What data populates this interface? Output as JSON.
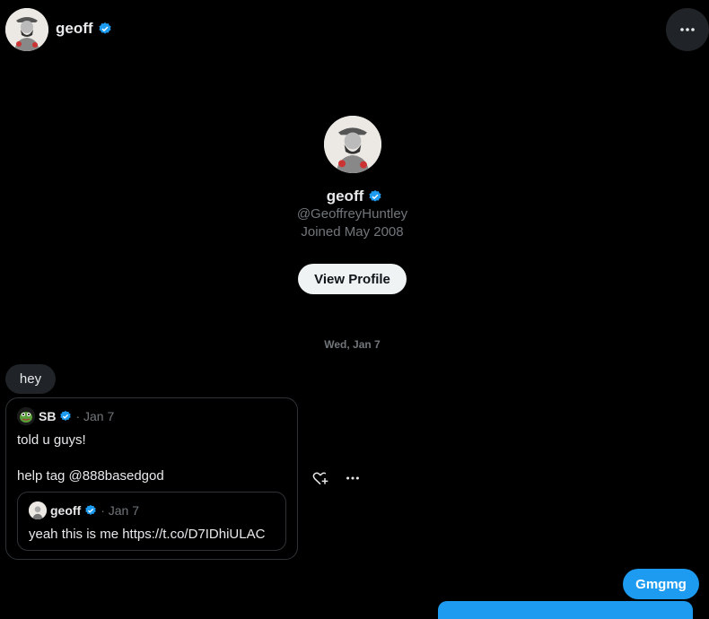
{
  "header": {
    "name": "geoff",
    "avatar_icon": "avatar-geoff-icon",
    "verified_icon": "verified-badge-icon",
    "more_icon": "more-horizontal-icon"
  },
  "profile": {
    "name": "geoff",
    "handle": "@GeoffreyHuntley",
    "joined": "Joined May 2008",
    "view_profile_label": "View Profile"
  },
  "conversation": {
    "date_separator": "Wed, Jan 7",
    "messages": [
      {
        "text": "hey"
      }
    ],
    "quote": {
      "author": "SB",
      "date": "· Jan 7",
      "line1": "told u guys!",
      "line2": "help tag @888basedgod",
      "inner": {
        "author": "geoff",
        "date": "· Jan 7",
        "text": "yeah this is me https://t.co/D7IDhiULAC"
      }
    },
    "outgoing": {
      "text": "Gmgmg"
    }
  },
  "colors": {
    "background": "#000000",
    "accent": "#1d9bf0",
    "muted": "#71767b",
    "bubble_in": "#202327",
    "button_light": "#eff3f4"
  }
}
